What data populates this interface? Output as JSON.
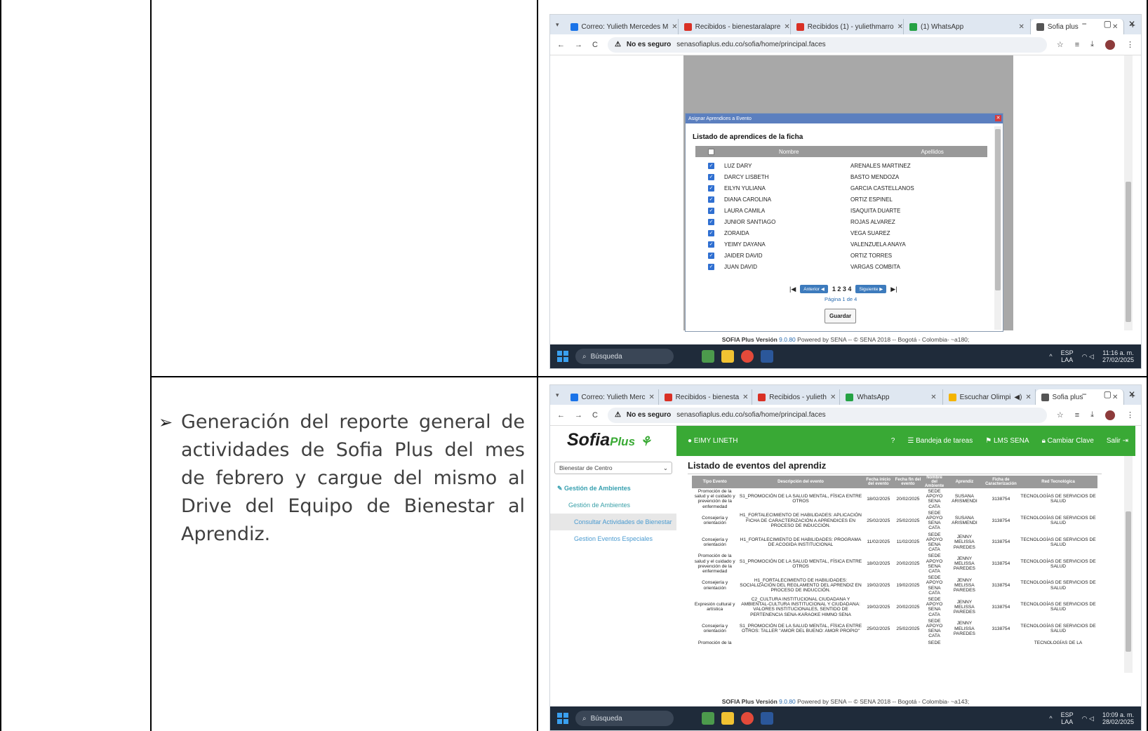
{
  "document": {
    "bullet_text": "Generación del reporte general de actividades de Sofia Plus del mes de febrero y cargue del mismo al Drive del Equipo de Bienestar al Aprendiz."
  },
  "screenshot1": {
    "tabs": [
      {
        "label": "Correo: Yulieth Mercedes M",
        "color": "#1a73e8"
      },
      {
        "label": "Recibidos - bienestaralapre",
        "color": "#d93025"
      },
      {
        "label": "Recibidos (1) - yuliethmarro",
        "color": "#d93025"
      },
      {
        "label": "(1) WhatsApp",
        "color": "#25a244"
      },
      {
        "label": "Sofia plus",
        "color": "#555555"
      }
    ],
    "insecure": "No es seguro",
    "url": "senasofiaplus.edu.co/sofia/home/principal.faces",
    "modal_title": "Asignar Aprendices a Evento",
    "modal_heading": "Listado de aprendices de la ficha",
    "col_nombre": "Nombre",
    "col_apellidos": "Apellidos",
    "rows": [
      {
        "nombre": "LUZ DARY",
        "apellidos": "ARENALES MARTINEZ"
      },
      {
        "nombre": "DARCY LISBETH",
        "apellidos": "BASTO MENDOZA"
      },
      {
        "nombre": "EILYN YULIANA",
        "apellidos": "GARCIA CASTELLANOS"
      },
      {
        "nombre": "DIANA CAROLINA",
        "apellidos": "ORTIZ ESPINEL"
      },
      {
        "nombre": "LAURA CAMILA",
        "apellidos": "ISAQUITA DUARTE"
      },
      {
        "nombre": "JUNIOR SANTIAGO",
        "apellidos": "ROJAS ALVAREZ"
      },
      {
        "nombre": "ZORAIDA",
        "apellidos": "VEGA SUAREZ"
      },
      {
        "nombre": "YEIMY DAYANA",
        "apellidos": "VALENZUELA ANAYA"
      },
      {
        "nombre": "JAIDER DAVID",
        "apellidos": "ORTIZ TORRES"
      },
      {
        "nombre": "JUAN DAVID",
        "apellidos": "VARGAS COMBITA"
      }
    ],
    "prev": "Anterior",
    "pages": "1 2 3 4",
    "next": "Siguiente",
    "page_info": "Página 1 de 4",
    "save": "Guardar",
    "footer_a": "SOFIA Plus Versión",
    "footer_v": "9.0.80",
    "footer_b": "Powered by SENA -- © SENA 2018 -- Bogotá - Colombia- ~a180;",
    "search": "Búsqueda",
    "lang1": "ESP",
    "lang2": "LAA",
    "time": "11:16 a. m.",
    "date": "27/02/2025"
  },
  "screenshot2": {
    "tabs": [
      {
        "label": "Correo: Yulieth Merc",
        "color": "#1a73e8"
      },
      {
        "label": "Recibidos - bienesta",
        "color": "#d93025"
      },
      {
        "label": "Recibidos - yulieth",
        "color": "#d93025"
      },
      {
        "label": "WhatsApp",
        "color": "#25a244"
      },
      {
        "label": "Escuchar Olimpi",
        "color": "#f4b400"
      },
      {
        "label": "Sofia plus",
        "color": "#555555"
      }
    ],
    "insecure": "No es seguro",
    "url": "senasofiaplus.edu.co/sofia/home/principal.faces",
    "logo": "Sofia",
    "logo_plus": "Plus",
    "user": "EIMY LINETH",
    "menu": [
      "Bandeja de tareas",
      "LMS SENA",
      "Cambiar Clave",
      "Salir"
    ],
    "side_select": "Bienestar de Centro",
    "side_group": "Gestión de Ambientes",
    "side_sub": "Gestión de Ambientes",
    "side_active": "Consultar Actividades de Bienestar",
    "side_other": "Gestion Eventos Especiales",
    "heading": "Listado de eventos del aprendiz",
    "headers": [
      "Tipo Evento",
      "Descripción del evento",
      "Fecha inicio del evento",
      "Fecha fin del evento",
      "Nombre del Ambiente",
      "Aprendiz",
      "Ficha de Caracterización",
      "Red Tecnológica"
    ],
    "rows": [
      [
        "Promoción de la salud y el cuidado y prevención de la enfermedad",
        "S1_PROMOCIÓN DE LA SALUD MENTAL, FÍSICA ENTRE OTROS",
        "18/02/2025",
        "20/02/2025",
        "SEDE APOYO SENA CATA",
        "SUSANA ARISMENDI",
        "3138754",
        "TECNOLOGÍAS DE SERVICIOS DE SALUD"
      ],
      [
        "Consejería y orientación",
        "H1_FORTALECIMIENTO DE HABILIDADES: APLICACIÓN FICHA DE CARACTERIZACIÓN A APRENDICES EN PROCESO DE INDUCCIÓN.",
        "25/02/2025",
        "25/02/2025",
        "SEDE APOYO SENA CATA",
        "SUSANA ARISMENDI",
        "3138754",
        "TECNOLOGÍAS DE SERVICIOS DE SALUD"
      ],
      [
        "Consejería y orientación",
        "H1_FORTALECIMIENTO DE HABILIDADES: PROGRAMA DE ACOGIDA INSTITUCIONAL",
        "11/02/2025",
        "11/02/2025",
        "SEDE APOYO SENA CATA",
        "JENNY MELISSA PAREDES",
        "3138754",
        "TECNOLOGÍAS DE SERVICIOS DE SALUD"
      ],
      [
        "Promoción de la salud y el cuidado y prevención de la enfermedad",
        "S1_PROMOCIÓN DE LA SALUD MENTAL, FÍSICA ENTRE OTROS",
        "18/02/2025",
        "20/02/2025",
        "SEDE APOYO SENA CATA",
        "JENNY MELISSA PAREDES",
        "3138754",
        "TECNOLOGÍAS DE SERVICIOS DE SALUD"
      ],
      [
        "Consejería y orientación",
        "H1_FORTALECIMIENTO DE HABILIDADES: SOCIALIZACIÓN DEL REGLAMENTO DEL APRENDIZ EN PROCESO DE INDUCCIÓN.",
        "19/02/2025",
        "19/02/2025",
        "SEDE APOYO SENA CATA",
        "JENNY MELISSA PAREDES",
        "3138754",
        "TECNOLOGÍAS DE SERVICIOS DE SALUD"
      ],
      [
        "Expresión cultural y artística",
        "C2_CULTURA INSTITUCIONAL CIUDADANA Y AMBIENTAL-CULTURA INSTITUCIONAL Y CIUDADANA: VALORES INSTITUCIONALES, SENTIDO DE PERTENENCIA SENA-KARAOKE HIMNO SENA",
        "19/02/2025",
        "20/02/2025",
        "SEDE APOYO SENA CATA",
        "JENNY MELISSA PAREDES",
        "3138754",
        "TECNOLOGÍAS DE SERVICIOS DE SALUD"
      ],
      [
        "Consejería y orientación",
        "S1_PROMOCIÓN DE LA SALUD MENTAL, FÍSICA ENTRE OTROS: TALLER \"AMOR DEL BUENO: AMOR PROPIO\"",
        "25/02/2025",
        "25/02/2025",
        "SEDE APOYO SENA CATA",
        "JENNY MELISSA PAREDES",
        "3138754",
        "TECNOLOGÍAS DE SERVICIOS DE SALUD"
      ],
      [
        "Promoción de la",
        "",
        "",
        "",
        "SEDE",
        "",
        "",
        "TECNOLOGÍAS DE LA"
      ]
    ],
    "footer_a": "SOFIA Plus Versión",
    "footer_v": "9.0.80",
    "footer_b": "Powered by SENA -- © SENA 2018 -- Bogotá - Colombia- ~a143;",
    "search": "Búsqueda",
    "lang1": "ESP",
    "lang2": "LAA",
    "time": "10:09 a. m.",
    "date": "28/02/2025"
  }
}
